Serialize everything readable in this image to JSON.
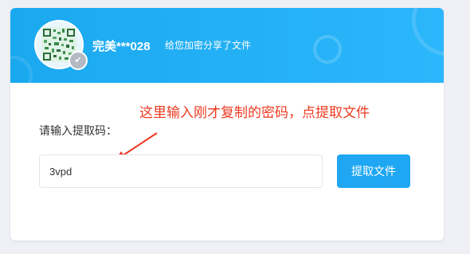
{
  "header": {
    "username": "完美***028",
    "share_text": "给您加密分享了文件",
    "avatar_icon": "qr-code-icon",
    "badge_icon": "check-badge-icon"
  },
  "annotation": {
    "text": "这里输入刚才复制的密码，点提取文件",
    "color": "#ec3a21"
  },
  "form": {
    "label": "请输入提取码：",
    "code_value": "3vpd",
    "button_label": "提取文件"
  },
  "colors": {
    "header_bg": "#1aa9ef",
    "button_bg": "#1fa7f3",
    "page_bg": "#eef0f5"
  }
}
